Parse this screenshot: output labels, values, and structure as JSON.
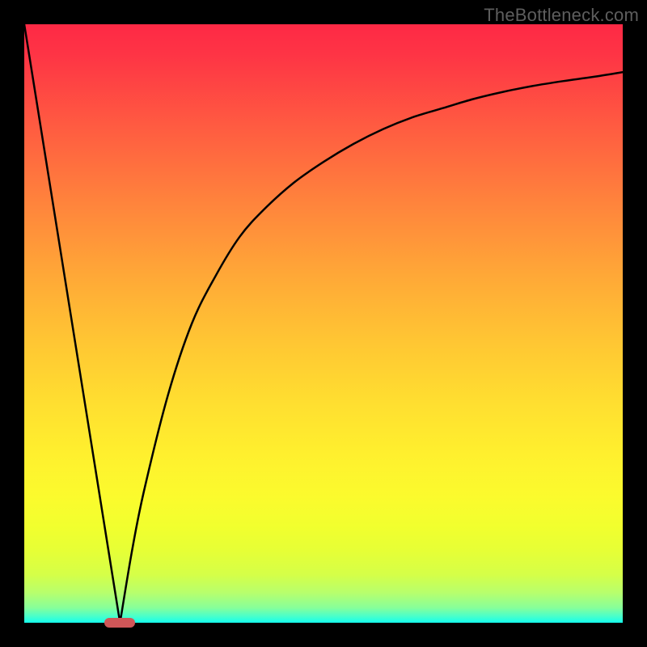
{
  "watermark": "TheBottleneck.com",
  "colors": {
    "background": "#000000",
    "marker": "#cf5658",
    "curve": "#000000"
  },
  "chart_data": {
    "type": "line",
    "title": "",
    "xlabel": "",
    "ylabel": "",
    "xlim": [
      0,
      100
    ],
    "ylim": [
      0,
      100
    ],
    "grid": false,
    "legend": false,
    "description": "Bottleneck-style V-curve: steep linear descent to a minimum near x≈16, then asymptotic rise toward ~92 at the right edge.",
    "minimum_x": 16,
    "series": [
      {
        "name": "curve",
        "x": [
          0,
          4,
          8,
          12,
          14,
          16,
          18,
          20,
          24,
          28,
          32,
          36,
          40,
          45,
          50,
          55,
          60,
          65,
          70,
          75,
          80,
          85,
          90,
          95,
          100
        ],
        "values": [
          100,
          75,
          50,
          25,
          12.5,
          0,
          12,
          22,
          38,
          50,
          58,
          64.5,
          69,
          73.5,
          77,
          80,
          82.5,
          84.5,
          86,
          87.5,
          88.7,
          89.7,
          90.5,
          91.2,
          92
        ]
      }
    ]
  }
}
